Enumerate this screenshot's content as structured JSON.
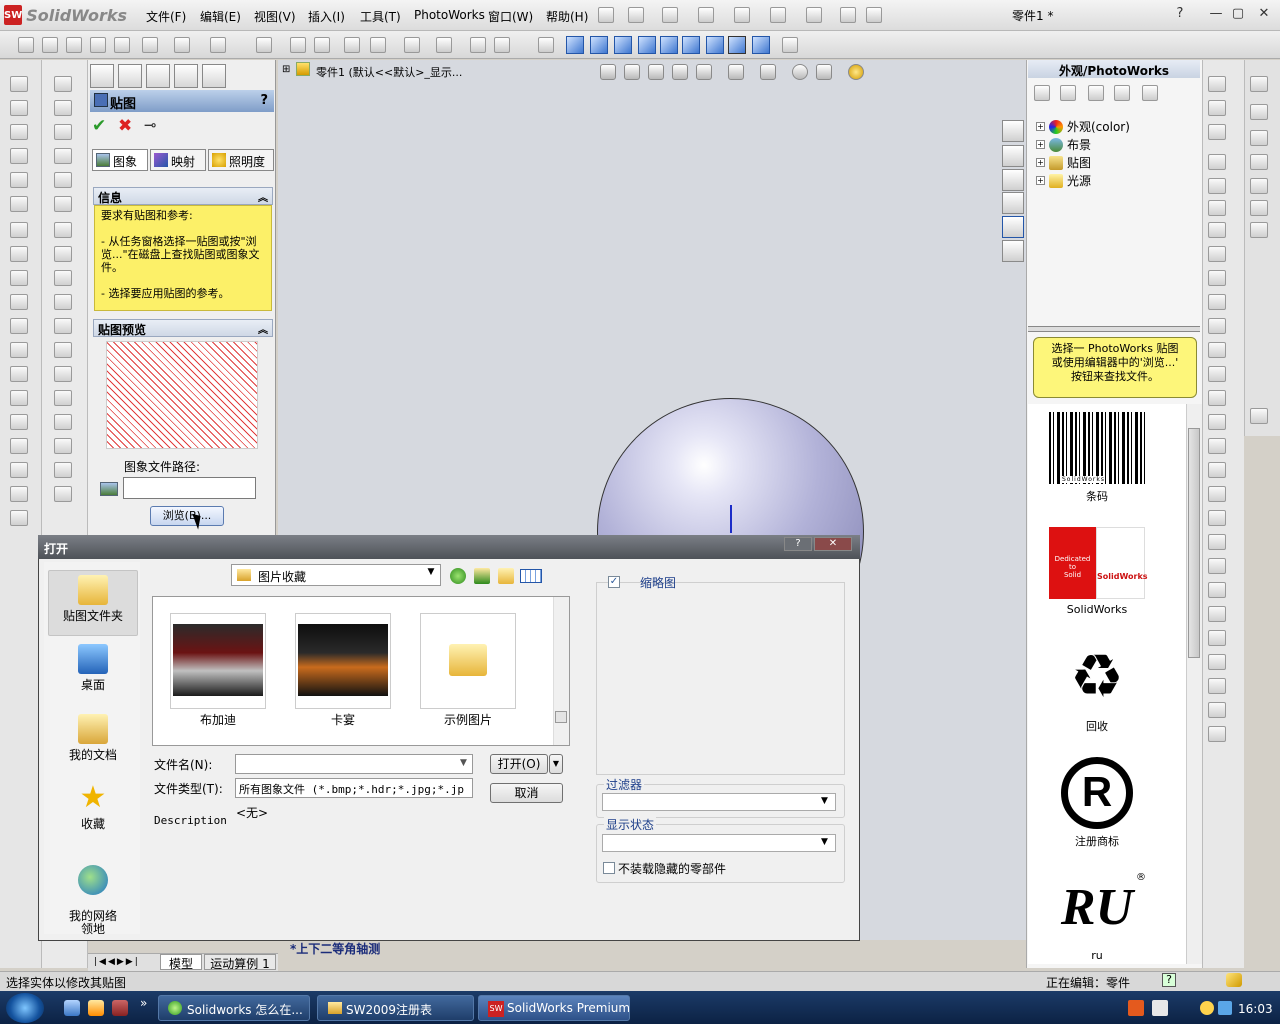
{
  "app": {
    "brand": "SolidWorks",
    "doc_title": "零件1 *",
    "menu": [
      "文件(F)",
      "编辑(E)",
      "视图(V)",
      "插入(I)",
      "工具(T)",
      "PhotoWorks",
      "窗口(W)",
      "帮助(H)"
    ],
    "help": "?",
    "min": "—",
    "max": "▢",
    "close": "✕"
  },
  "property_manager": {
    "title": "贴图",
    "help": "?",
    "ok": "✔",
    "cancel": "✖",
    "pin": "⊸",
    "tabs": [
      "图象",
      "映射",
      "照明度"
    ],
    "info_group": "信息",
    "info_text": "要求有贴图和参考:\n\n- 从任务窗格选择一贴图或按\"浏览...\"在磁盘上查找贴图或图象文件。\n\n- 选择要应用贴图的参考。",
    "preview_group": "贴图预览",
    "path_label": "图象文件路径:",
    "path_value": "",
    "browse_label": "浏览(B)...",
    "chevron": "︽"
  },
  "feature_tree": {
    "root": "零件1 (默认<<默认>_显示..."
  },
  "graphics": {
    "view_label": "*上下二等角轴测"
  },
  "task_pane": {
    "title": "外观/PhotoWorks",
    "tree": [
      "外观(color)",
      "布景",
      "贴图",
      "光源"
    ],
    "hint": "选择一 PhotoWorks 贴图\n或使用编辑器中的'浏览...'\n按钮来查找文件。",
    "items": [
      {
        "label": "条码"
      },
      {
        "label": "SolidWorks"
      },
      {
        "label": "回收"
      },
      {
        "label": "注册商标"
      },
      {
        "label": "ru"
      }
    ],
    "thumb_text": {
      "barcode": "SolidWorks",
      "sw_left": "Dedicated\nto\nSolid",
      "sw_right": "SolidWorks",
      "recycle": "♻",
      "registered": "R",
      "ru": "RU",
      "ru_mark": "®"
    }
  },
  "bottom_tabs": [
    "模型",
    "运动算例 1"
  ],
  "status": {
    "left": "选择实体以修改其贴图",
    "right": "正在编辑：零件",
    "help": "?"
  },
  "taskbar": {
    "buttons": [
      "Solidworks 怎么在...",
      "SW2009注册表",
      "SolidWorks Premium ..."
    ],
    "time": "16:03",
    "more": "»"
  },
  "open_dialog": {
    "title": "打开",
    "help": "?",
    "close": "✕",
    "places": [
      "贴图文件夹",
      "桌面",
      "我的文档",
      "收藏",
      "我的网络\n领地"
    ],
    "look_in": "图片收藏",
    "files": [
      "布加迪",
      "卡宴",
      "示例图片"
    ],
    "filename_label": "文件名(N):",
    "filename_value": "",
    "filetype_label": "文件类型(T):",
    "filetype_value": "所有图象文件 (*.bmp;*.hdr;*.jpg;*.jp",
    "description_label": "Description",
    "description_value": "<无>",
    "open_label": "打开(O)",
    "cancel_label": "取消",
    "thumbnail_label": "缩略图",
    "thumbnail_checked": true,
    "filter_label": "过滤器",
    "filter_value": "",
    "display_state_label": "显示状态",
    "display_state_value": "",
    "no_hidden_label": "不装载隐藏的零部件",
    "no_hidden_checked": false
  },
  "colors": {
    "info_bg": "#fcf068",
    "accent": "#2456a8"
  }
}
